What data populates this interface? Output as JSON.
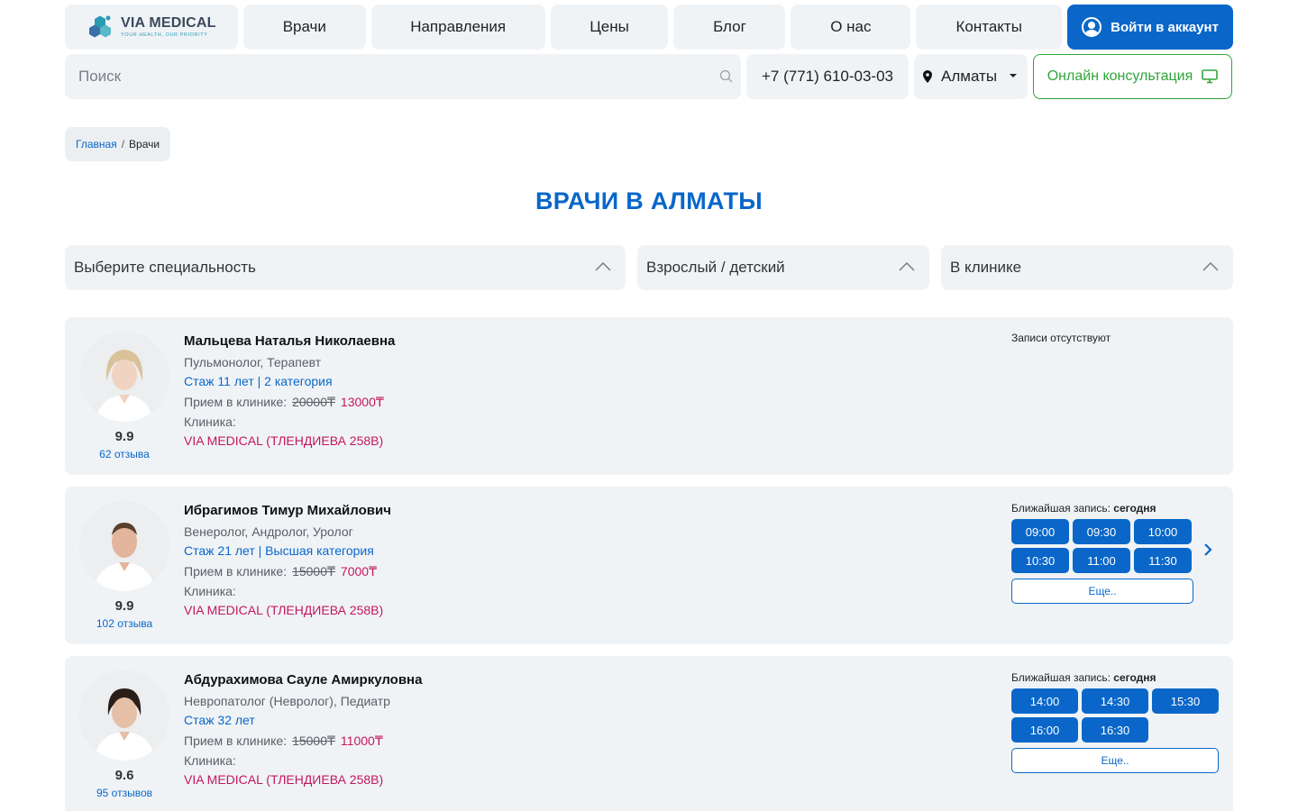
{
  "header": {
    "logo_name": "VIA MEDICAL",
    "logo_tagline": "YOUR HEALTH, OUR PRIORITY",
    "nav": [
      "Врачи",
      "Направления",
      "Цены",
      "Блог",
      "О нас",
      "Контакты"
    ],
    "login_label": "Войти в аккаунт"
  },
  "toolbar": {
    "search_placeholder": "Поиск",
    "phone": "+7 (771) 610-03-03",
    "city": "Алматы",
    "consult_label": "Онлайн консультация"
  },
  "breadcrumb": {
    "home": "Главная",
    "separator": "/",
    "current": "Врачи"
  },
  "page_title": "ВРАЧИ В АЛМАТЫ",
  "filters": {
    "specialty": "Выберите специальность",
    "age": "Взрослый / детский",
    "place": "В клинике"
  },
  "labels": {
    "price_prefix": "Прием в клинике:",
    "clinic": "Клиника:",
    "next_prefix": "Ближайшая запись:",
    "more": "Еще.."
  },
  "doctors": [
    {
      "name": "Мальцева Наталья Николаевна",
      "specialty": "Пульмонолог, Терапевт",
      "experience": "Стаж 11 лет | 2 категория",
      "price_old": "20000₸",
      "price_new": "13000₸",
      "clinic": "VIA MEDICAL (ТЛЕНДИЕВА 258В)",
      "rating": "9.9",
      "reviews": "62 отзыва",
      "no_slots": "Записи отсутствуют"
    },
    {
      "name": "Ибрагимов Тимур Михайлович",
      "specialty": "Венеролог, Андролог, Уролог",
      "experience": "Стаж 21 лет | Высшая категория",
      "price_old": "15000₸",
      "price_new": "7000₸",
      "clinic": "VIA MEDICAL (ТЛЕНДИЕВА 258В)",
      "rating": "9.9",
      "reviews": "102 отзыва",
      "next_day": "сегодня",
      "slots": [
        "09:00",
        "09:30",
        "10:00",
        "10:30",
        "11:00",
        "11:30"
      ]
    },
    {
      "name": "Абдурахимова Сауле Амиркуловна",
      "specialty": "Невропатолог (Невролог), Педиатр",
      "experience": "Стаж 32 лет",
      "price_old": "15000₸",
      "price_new": "11000₸",
      "clinic": "VIA MEDICAL (ТЛЕНДИЕВА 258В)",
      "rating": "9.6",
      "reviews": "95 отзывов",
      "next_day": "сегодня",
      "slots": [
        "14:00",
        "14:30",
        "15:30",
        "16:00",
        "16:30"
      ]
    }
  ],
  "colors": {
    "primary": "#0a67c9",
    "accent_green": "#2fa53a",
    "price": "#c2185b",
    "panel": "#f0f3f6"
  },
  "icons": {
    "search": "search-icon",
    "pin": "map-pin-icon",
    "monitor": "monitor-icon",
    "user": "user-icon",
    "chevron": "chevron-up-icon",
    "next": "chevron-right-icon"
  }
}
